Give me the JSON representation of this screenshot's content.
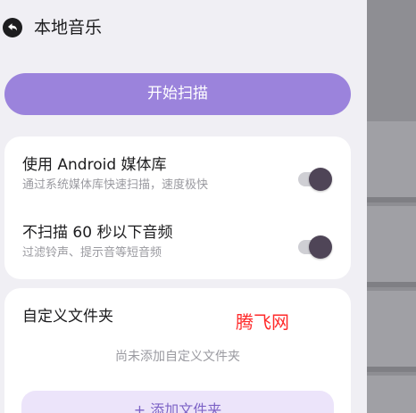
{
  "header": {
    "back_icon": "back-arrow-icon",
    "title": "本地音乐"
  },
  "scan": {
    "button_label": "开始扫描"
  },
  "media_settings": [
    {
      "title": "使用 Android 媒体库",
      "subtitle": "通过系统媒体库快速扫描，速度极快",
      "enabled": true
    },
    {
      "title": "不扫描 60 秒以下音频",
      "subtitle": "过滤铃声、提示音等短音频",
      "enabled": true
    }
  ],
  "custom_folders": {
    "title": "自定义文件夹",
    "empty_text": "尚未添加自定义文件夹",
    "add_button_label": "+ 添加文件夹"
  },
  "watermark": {
    "text": "腾飞网"
  },
  "colors": {
    "accent": "#9b83dc",
    "accent_light": "#ece4fa",
    "accent_text": "#7d63c6",
    "page_background": "#f0eff4",
    "card_background": "#ffffff",
    "toggle_knob": "#4f4557",
    "toggle_track": "#cfcfd4",
    "watermark": "#ff2a2a"
  }
}
